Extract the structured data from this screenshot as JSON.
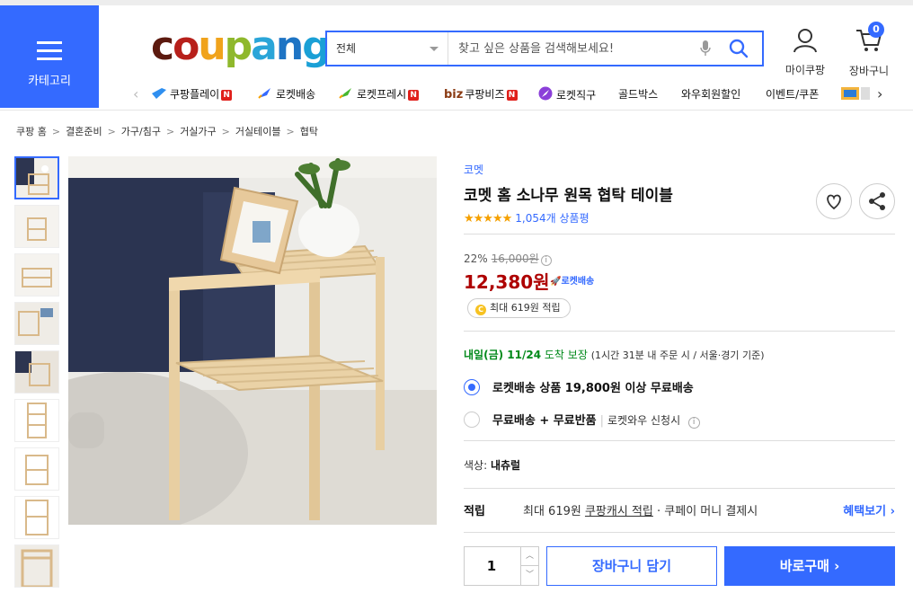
{
  "header": {
    "category_label": "카테고리",
    "logo": [
      "c",
      "o",
      "u",
      "p",
      "a",
      "n",
      "g"
    ],
    "search": {
      "select_value": "전체",
      "placeholder": "찾고 싶은 상품을 검색해보세요!"
    },
    "mycoupang_label": "마이쿠팡",
    "cart_label": "장바구니",
    "cart_count": "0"
  },
  "nav": {
    "items": [
      {
        "label": "쿠팡플레이",
        "new": "N",
        "icon": "play-icon"
      },
      {
        "label": "로켓배송",
        "icon": "rocket-icon"
      },
      {
        "label": "로켓프레시",
        "new": "N",
        "icon": "fresh-rocket-icon"
      },
      {
        "label": "쿠팡비즈",
        "prefix": "biz",
        "new": "N"
      },
      {
        "label": "로켓직구",
        "icon": "global-rocket-icon"
      },
      {
        "label": "골드박스"
      },
      {
        "label": "와우회원할인"
      },
      {
        "label": "이벤트/쿠폰"
      }
    ]
  },
  "breadcrumb": [
    "쿠팡 홈",
    "결혼준비",
    "가구/침구",
    "거실가구",
    "거실테이블",
    "협탁"
  ],
  "product": {
    "brand": "코멧",
    "title": "코멧 홈 소나무 원목 협탁 테이블",
    "rating_stars": "★★★★★",
    "rating_value": 4.5,
    "review_count": "1,054개 상품평",
    "discount_rate": "22%",
    "original_price": "16,000원",
    "sale_price": "12,380원",
    "rocket_tag": "로켓배송",
    "cash_reward": "최대 619원 적립",
    "delivery": {
      "date": "내일(금) 11/24",
      "guarantee": "도착 보장",
      "detail": "(1시간 31분  내 주문 시 / 서울·경기 기준)"
    },
    "shipping_options": [
      {
        "main": "로켓배송 상품 19,800원 이상 무료배송",
        "selected": true
      },
      {
        "main": "무료배송 + 무료반품",
        "sub": "로켓와우 신청시",
        "selected": false
      }
    ],
    "color_label": "색상:",
    "color_value": "내츄럴",
    "reward": {
      "label": "적립",
      "text_pre": "최대 619원 ",
      "text_link": "쿠팡캐시 적립",
      "text_post": " · 쿠페이 머니 결제시",
      "more": "혜택보기 ›"
    },
    "quantity": "1",
    "add_to_cart": "장바구니 담기",
    "buy_now": "바로구매 ›"
  },
  "colors": {
    "accent": "#346aff",
    "price_red": "#ae0000",
    "delivery_green": "#00891a",
    "star": "#f5a000"
  }
}
